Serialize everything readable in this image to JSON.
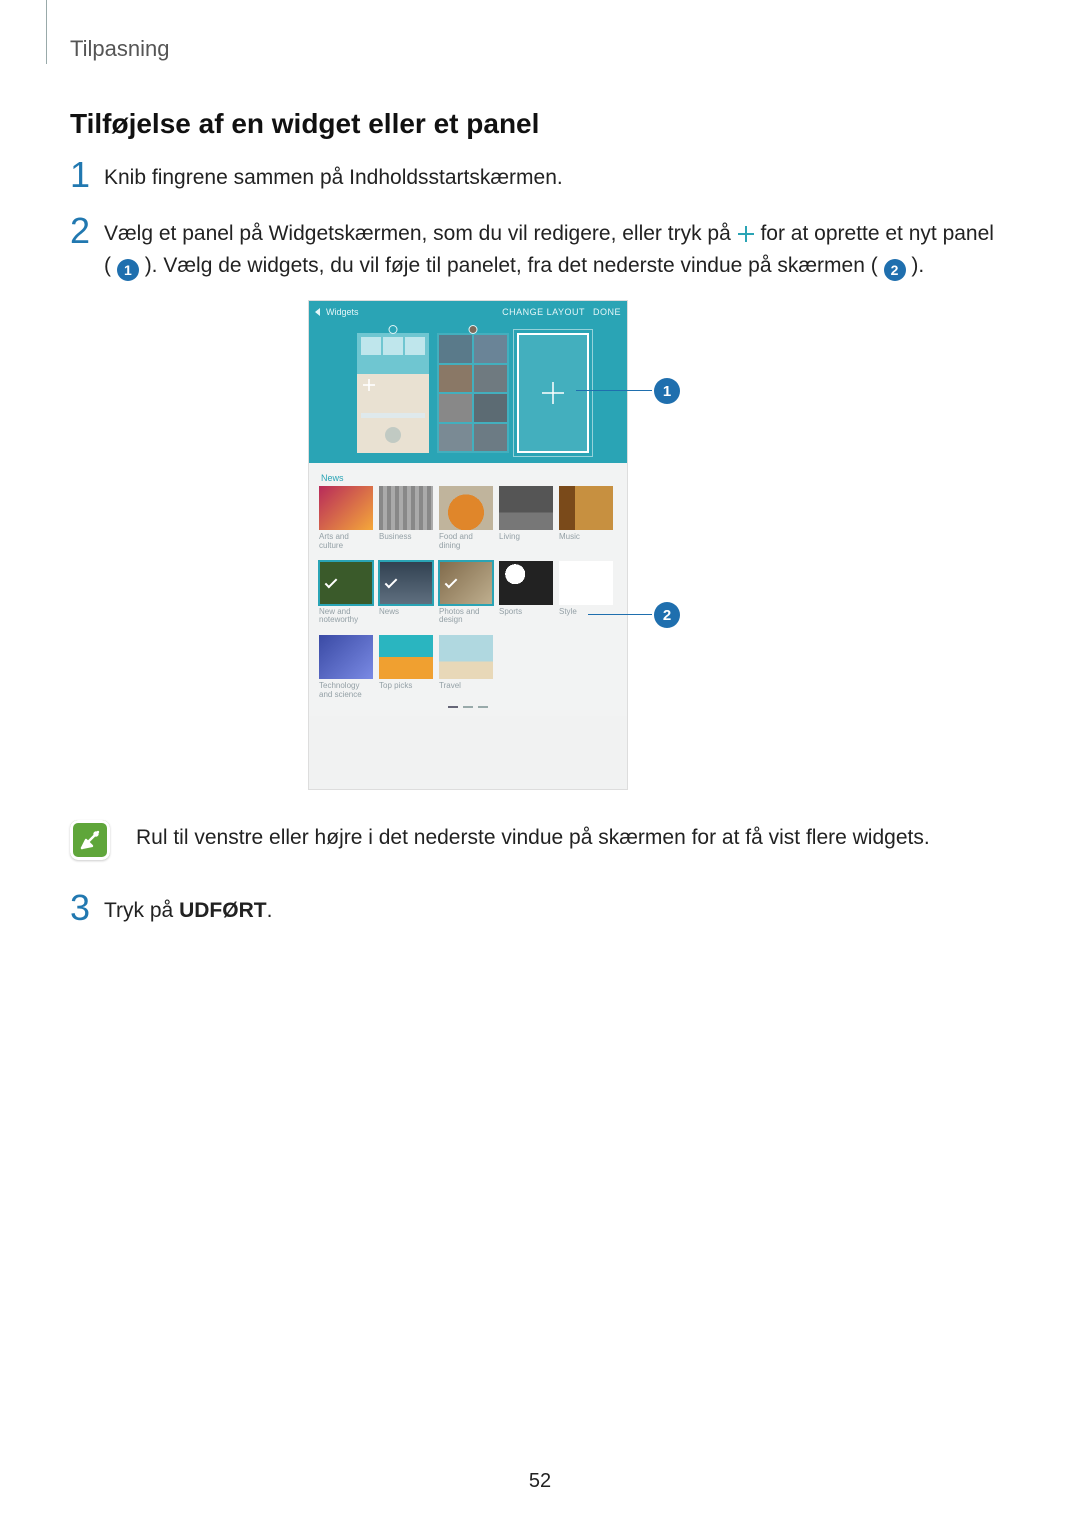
{
  "breadcrumb": "Tilpasning",
  "section_title": "Tilføjelse af en widget eller et panel",
  "steps": {
    "s1": {
      "num": "1",
      "body": "Knib fingrene sammen på Indholdsstartskærmen."
    },
    "s2": {
      "num": "2",
      "body_a": "Vælg et panel på Widgetskærmen, som du vil redigere, eller tryk på ",
      "body_b": " for at oprette et nyt panel (",
      "body_c": "). Vælg de widgets, du vil føje til panelet, fra det nederste vindue på skærmen (",
      "body_d": ")."
    },
    "s3": {
      "num": "3",
      "body_a": "Tryk på ",
      "body_bold": "UDFØRT",
      "body_b": "."
    }
  },
  "badges": {
    "b1": "1",
    "b2": "2"
  },
  "figure": {
    "header": {
      "title": "Widgets",
      "action_layout": "CHANGE LAYOUT",
      "action_done": "DONE"
    },
    "section_label": "News",
    "row1": [
      {
        "caption": "Arts and culture"
      },
      {
        "caption": "Business"
      },
      {
        "caption": "Food and dining"
      },
      {
        "caption": "Living"
      },
      {
        "caption": "Music"
      }
    ],
    "row2": [
      {
        "caption": "New and noteworthy",
        "selected": true
      },
      {
        "caption": "News",
        "selected": true
      },
      {
        "caption": "Photos and design",
        "selected": true
      },
      {
        "caption": "Sports"
      },
      {
        "caption": "Style"
      }
    ],
    "row3": [
      {
        "caption": "Technology and science"
      },
      {
        "caption": "Top picks"
      },
      {
        "caption": "Travel"
      }
    ]
  },
  "callouts": {
    "c1": "1",
    "c2": "2"
  },
  "note": "Rul til venstre eller højre i det nederste vindue på skærmen for at få vist flere widgets.",
  "page_number": "52"
}
